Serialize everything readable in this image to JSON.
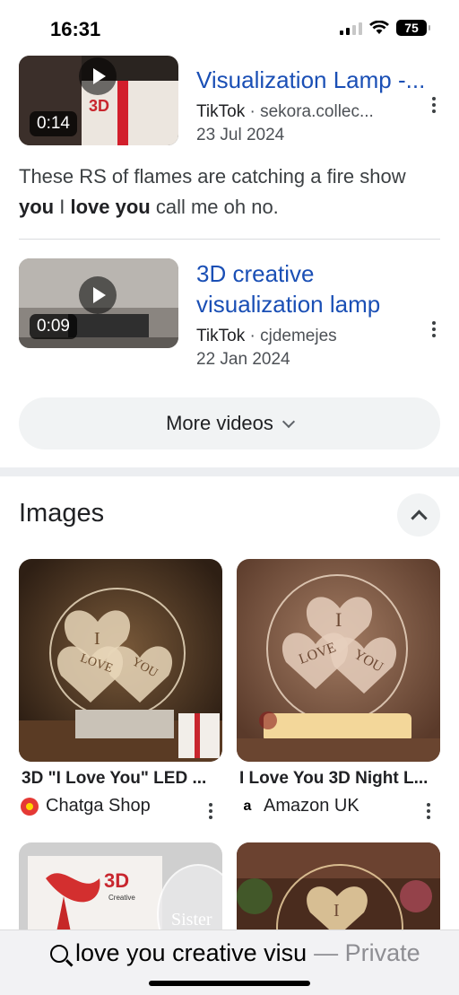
{
  "status": {
    "time": "16:31",
    "battery": "75"
  },
  "videos": [
    {
      "title_line": "Visualization Lamp -...",
      "platform": "TikTok",
      "domain": "sekora.collec...",
      "date": "23 Jul 2024",
      "duration": "0:14",
      "thumb_badge": "3D"
    },
    {
      "title": "3D creative visualization lamp",
      "platform": "TikTok",
      "domain": "cjdemejes",
      "date": "22 Jan 2024",
      "duration": "0:09"
    }
  ],
  "snippet": {
    "part1": "These RS of flames are catching a fire show ",
    "bold1": "you",
    "part2": " I ",
    "bold2": "love you",
    "part3": " call me oh no."
  },
  "more_videos_label": "More videos",
  "images_section": {
    "title": "Images",
    "items": [
      {
        "title": "3D \"I Love You\" LED ...",
        "source": "Chatga Shop",
        "favicon_color": "#e53935"
      },
      {
        "title": "I Love You 3D Night L...",
        "source": "Amazon UK",
        "favicon_glyph": "a"
      }
    ]
  },
  "image_text": {
    "heart_i": "I",
    "love": "LOVE",
    "you": "YOU",
    "badge_3d": "3D",
    "creative": "Creative",
    "sister": "Sister"
  },
  "search_bar": {
    "query": "love you creative visu",
    "mode": "— Private"
  },
  "colors": {
    "link": "#1a4fb5",
    "pill_bg": "#f1f3f4"
  }
}
